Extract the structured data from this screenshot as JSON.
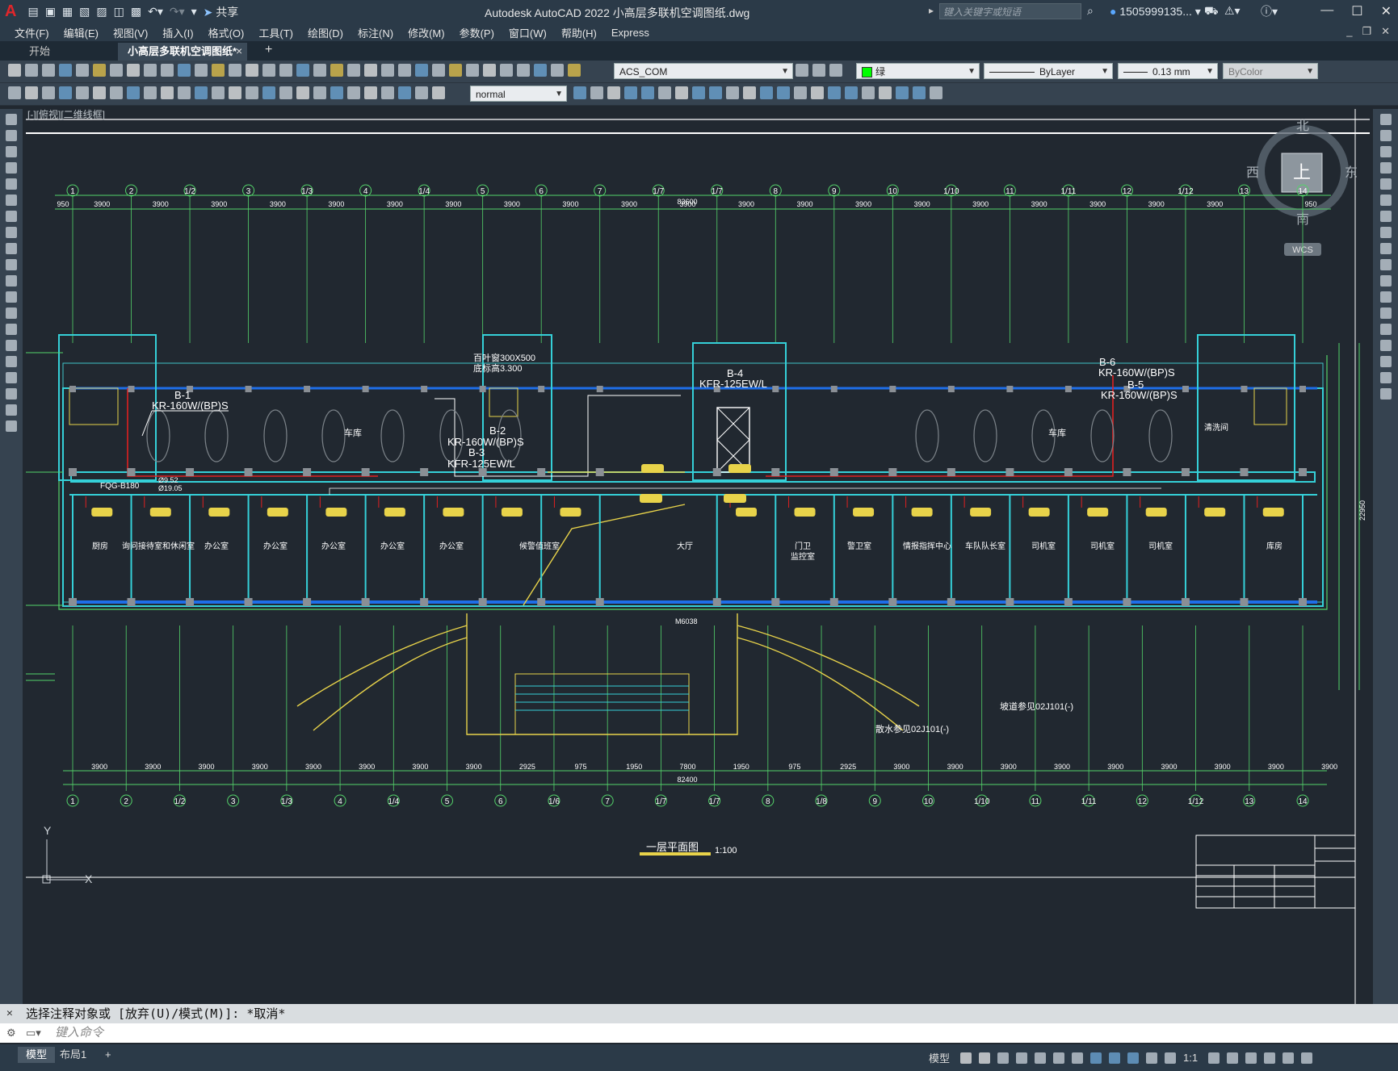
{
  "app": {
    "title": "Autodesk AutoCAD 2022    小高层多联机空调图纸.dwg",
    "share_label": "共享",
    "search_placeholder": "键入关键字或短语",
    "account": "1505999135...",
    "logo": "A"
  },
  "menu": [
    "文件(F)",
    "编辑(E)",
    "视图(V)",
    "插入(I)",
    "格式(O)",
    "工具(T)",
    "绘图(D)",
    "标注(N)",
    "修改(M)",
    "参数(P)",
    "窗口(W)",
    "帮助(H)",
    "Express"
  ],
  "tabs": {
    "start": "开始",
    "file": "小高层多联机空调图纸*",
    "close": "×",
    "add": "+"
  },
  "properties": {
    "ucs": "ACS_COM",
    "color": "绿",
    "linetype": "ByLayer",
    "lineweight": "0.13 mm",
    "plotstyle": "ByColor",
    "textstyle": "normal",
    "accent_green": "#00ff00"
  },
  "viewcube": {
    "north": "北",
    "south": "南",
    "east": "东",
    "west": "西",
    "top": "上",
    "wcs": "WCS"
  },
  "viewport_label": "[-][俯视][二维线框]",
  "drawing": {
    "grid_top": [
      "1",
      "2",
      "1/2",
      "3",
      "1/3",
      "4",
      "1/4",
      "5",
      "6",
      "7",
      "1/7",
      "1/7",
      "8",
      "9",
      "10",
      "1/10",
      "11",
      "1/11",
      "12",
      "1/12",
      "13",
      "14"
    ],
    "grid_bottom": [
      "1",
      "2",
      "1/2",
      "3",
      "1/3",
      "4",
      "1/4",
      "5",
      "6",
      "1/6",
      "7",
      "1/7",
      "1/7",
      "8",
      "1/8",
      "9",
      "10",
      "1/10",
      "11",
      "1/11",
      "12",
      "1/12",
      "13",
      "14"
    ],
    "top_dims": [
      "950",
      "3900",
      "3900",
      "3900",
      "3900",
      "3900",
      "3900",
      "3900",
      "3900",
      "3900",
      "3900",
      "3900",
      "3900",
      "3900",
      "3900",
      "3900",
      "3900",
      "3900",
      "3900",
      "3900",
      "3900",
      "950"
    ],
    "top_total": "83600",
    "bottom_dims": [
      "3900",
      "3900",
      "3900",
      "3900",
      "3900",
      "3900",
      "3900",
      "3900",
      "2925",
      "975",
      "1950",
      "7800",
      "1950",
      "975",
      "2925",
      "3900",
      "3900",
      "3900",
      "3900",
      "3900",
      "3900",
      "3900",
      "3900",
      "3900"
    ],
    "bottom_total": "82400",
    "ac_labels": {
      "b1": "B-1",
      "b1_model": "KR-160W/(BP)S",
      "b2": "B-2",
      "b2_model": "KR-160W/(BP)S",
      "b3": "B-3",
      "b3_model": "KFR-125EW/L",
      "b4": "B-4",
      "b4_model": "KFR-125EW/L",
      "b6": "B-6",
      "b6_model": "KR-160W/(BP)S",
      "b5": "B-5",
      "b5_model": "KR-160W/(BP)S"
    },
    "louver": "百叶窗300X500",
    "louver_height": "底标高3.300",
    "garage": "车库",
    "garage2": "车库",
    "rooms": [
      "厨房",
      "询问接待室和休闲室",
      "办公室",
      "办公室",
      "办公室",
      "办公室",
      "办公室",
      "候警值班室",
      "大厅",
      "门卫",
      "监控室",
      "警卫室",
      "情报指挥中心",
      "车队队长室",
      "司机室",
      "司机室",
      "司机室",
      "库房"
    ],
    "refrigerant": "FQG-B180",
    "pipe_dia1": "Ø9.52",
    "pipe_dia2": "Ø19.05",
    "ramp_note": "坡道参见02J101(-)",
    "ramp_note2": "散水参见02J101(-)",
    "side_total": "22950",
    "plan_title": "一层平面图",
    "plan_scale": "1:100",
    "washroom": "清洗间",
    "hall_door": "M6038"
  },
  "command": {
    "history": "选择注释对象或 [放弃(U)/模式(M)]: *取消*",
    "placeholder": "键入命令"
  },
  "status": {
    "model_tab": "模型",
    "layout_tab": "布局1",
    "add": "+",
    "model_label": "模型",
    "scale": "1:1"
  }
}
